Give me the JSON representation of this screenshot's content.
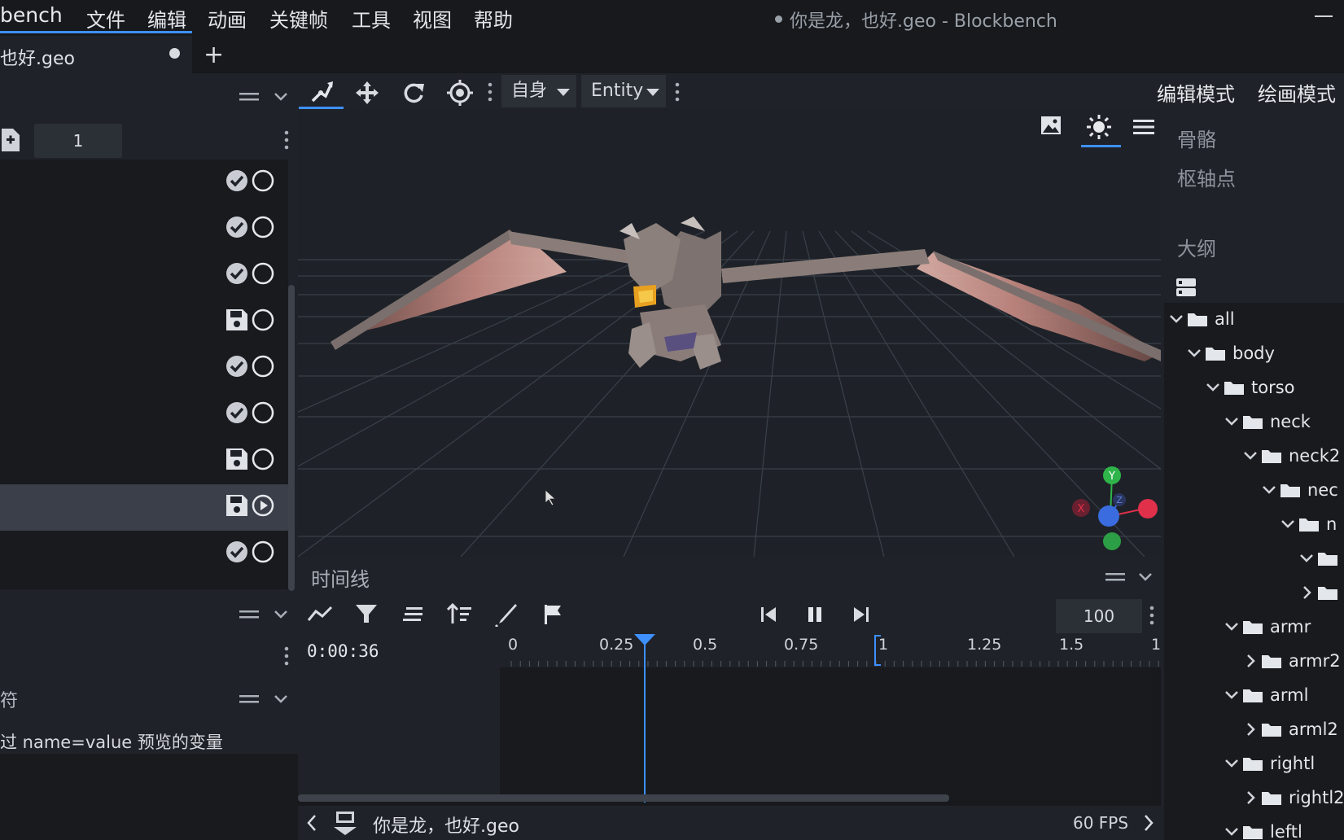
{
  "app": {
    "name": "bench",
    "window_title": "你是龙，也好.geo - Blockbench"
  },
  "menu": [
    "文件",
    "编辑",
    "动画",
    "关键帧",
    "工具",
    "视图",
    "帮助"
  ],
  "tab": {
    "label": "也好.geo"
  },
  "left_panel": {
    "animation_count": "1",
    "variables_label": "符",
    "variables_hint": "过 name=value 预览的变量"
  },
  "viewport_toolbar": {
    "space_dropdown": "自身",
    "entity_dropdown": "Entity"
  },
  "modes": {
    "edit": "编辑模式",
    "paint": "绘画模式"
  },
  "right_panel": {
    "bones_label": "骨骼",
    "pivot_label": "枢轴点",
    "outliner_label": "大纲",
    "tree": [
      {
        "label": "all",
        "expanded": true
      },
      {
        "label": "body",
        "expanded": true
      },
      {
        "label": "torso",
        "expanded": true
      },
      {
        "label": "neck",
        "expanded": true
      },
      {
        "label": "neck2",
        "expanded": true
      },
      {
        "label": "nec",
        "expanded": true
      },
      {
        "label": "n",
        "expanded": true
      },
      {
        "label": "",
        "expanded": true
      },
      {
        "label": "",
        "expanded": false
      },
      {
        "label": "armr",
        "expanded": true
      },
      {
        "label": "armr2",
        "expanded": false
      },
      {
        "label": "arml",
        "expanded": true
      },
      {
        "label": "arml2",
        "expanded": false
      },
      {
        "label": "rightl",
        "expanded": true
      },
      {
        "label": "rightl2",
        "expanded": false
      },
      {
        "label": "leftl",
        "expanded": true
      }
    ]
  },
  "timeline": {
    "title": "时间线",
    "time": "0:00:36",
    "fps_input": "100",
    "ruler": [
      "0",
      "0.25",
      "0.5",
      "0.75",
      "1",
      "1.25",
      "1.5",
      "1."
    ],
    "playhead_seconds": 0.36
  },
  "statusbar": {
    "file": "你是龙，也好.geo",
    "fps": "60 FPS"
  },
  "gizmo": {
    "x_label": "X",
    "y_label": "Y",
    "z_label": "Z"
  },
  "colors": {
    "accent": "#3e90ff",
    "axis_x": "#e0304a",
    "axis_y": "#2fb44a",
    "axis_z": "#3a6ce0"
  }
}
